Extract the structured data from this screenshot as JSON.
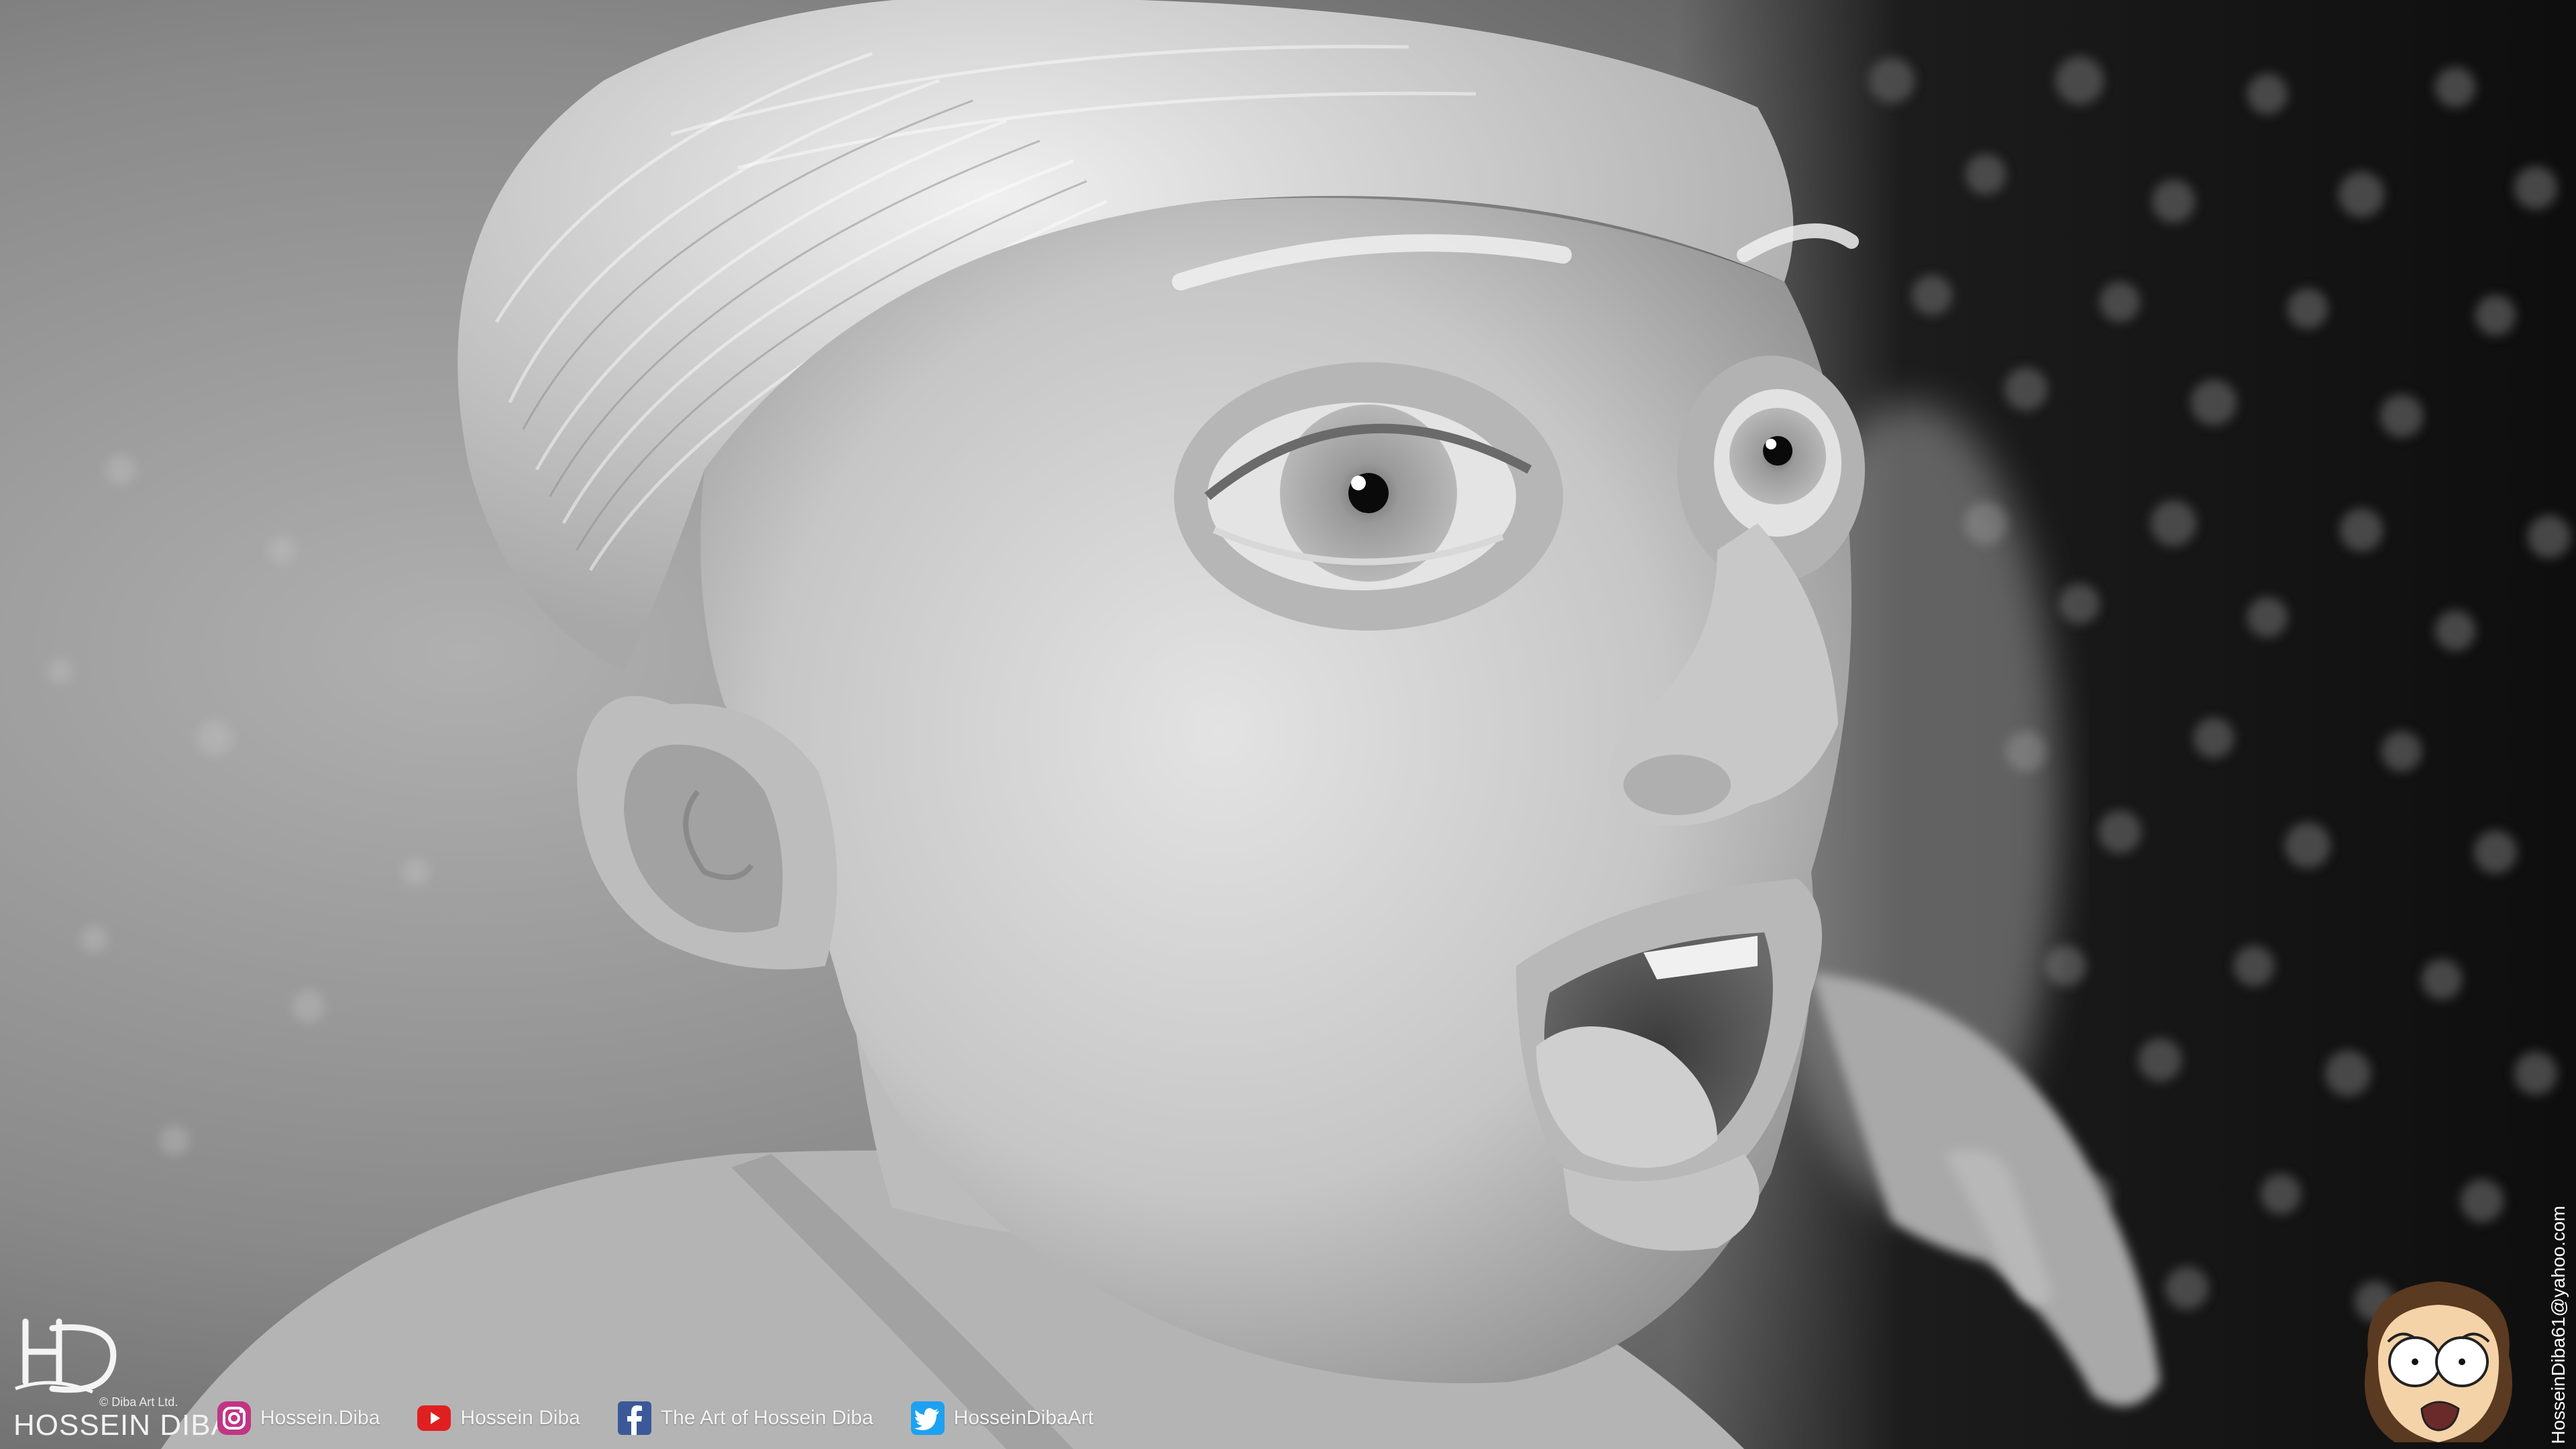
{
  "artwork": {
    "subject": "3d-portrait-render",
    "palette": {
      "background_dark": "#141414",
      "background_light": "#9c9c9c",
      "skin": "#cfcfcf",
      "hair": "#e2e2e2"
    }
  },
  "brand": {
    "name": "HOSSEIN DIBA",
    "ltd": "© Diba Art Ltd.",
    "logo_icon": "hd-signature-logo"
  },
  "socials": [
    {
      "icon": "instagram-icon",
      "label": "Hossein.Diba",
      "color": "#c13584"
    },
    {
      "icon": "youtube-icon",
      "label": "Hossein Diba",
      "color": "#e02020"
    },
    {
      "icon": "facebook-icon",
      "label": "The Art of Hossein Diba",
      "color": "#3b5998"
    },
    {
      "icon": "twitter-icon",
      "label": "HosseinDibaArt",
      "color": "#1da1f2"
    }
  ],
  "contact": {
    "email": "HosseinDiba61@yahoo.com"
  },
  "mascot": {
    "icon": "cartoon-boy-face-icon",
    "skin_color": "#f5d3a8",
    "hair_color": "#5a3a20"
  }
}
